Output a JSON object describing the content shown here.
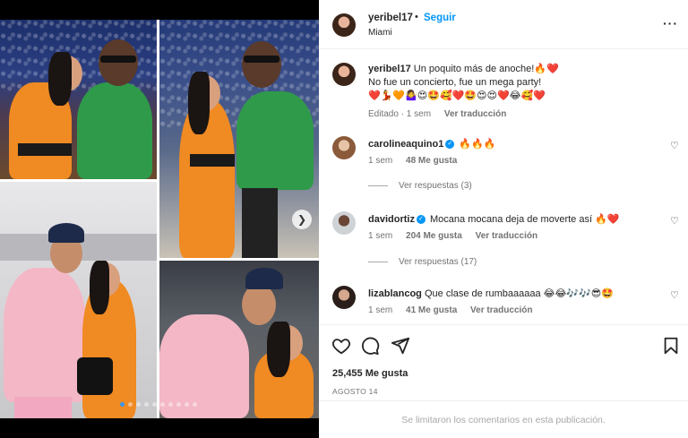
{
  "post": {
    "username": "yeribel17",
    "follow_label": "Seguir",
    "location": "Miami",
    "caption_line1": "Un poquito más de anoche!🔥❤️",
    "caption_line2": "No fue un concierto, fue un mega party!",
    "caption_emojis": "❤️💃🧡🤷‍♀️😍🤩🥰❤️🤩😍😍❤️😂🥰❤️",
    "caption_meta_edited": "Editado · 1 sem",
    "translate_label": "Ver traducción"
  },
  "comments": [
    {
      "username": "carolineaquino1",
      "verified": true,
      "text": "🔥🔥🔥",
      "time": "1 sem",
      "likes": "48 Me gusta",
      "replies": "Ver respuestas (3)"
    },
    {
      "username": "davidortiz",
      "verified": true,
      "text": "Mocana mocana deja de moverte así 🔥❤️",
      "time": "1 sem",
      "likes": "204 Me gusta",
      "translate": "Ver traducción",
      "replies": "Ver respuestas (17)"
    },
    {
      "username": "lizablancog",
      "verified": false,
      "text": "Que clase de rumbaaaaaa 😂😂🎶🎶😎🤩",
      "time": "1 sem",
      "likes": "41 Me gusta",
      "translate": "Ver traducción"
    }
  ],
  "footer": {
    "likes": "25,455 Me gusta",
    "date": "AGOSTO 14",
    "limited_notice": "Se limitaron los comentarios en esta publicación."
  },
  "icons": {
    "heart": "heart-icon",
    "comment": "comment-icon",
    "share": "share-icon",
    "save": "bookmark-icon",
    "more": "more-options-icon",
    "next": "chevron-right-icon"
  },
  "carousel": {
    "total_slides": 10,
    "current_slide": 1
  },
  "colors": {
    "accent": "#0095f6",
    "muted": "#737373",
    "orange_outfit": "#f08a22"
  }
}
